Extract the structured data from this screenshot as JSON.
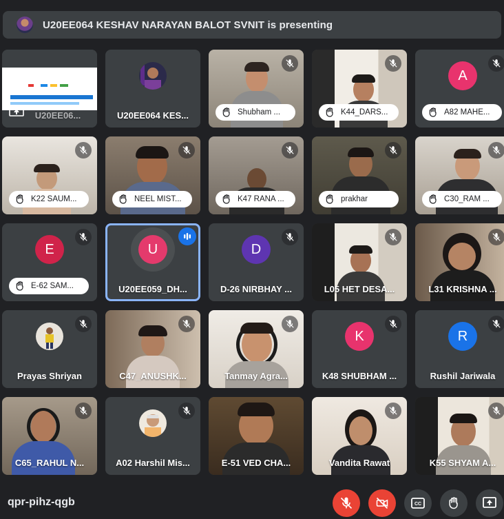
{
  "banner": {
    "text": "U20EE064 KESHAV NARAYAN BALOT SVNIT is presenting"
  },
  "tiles": [
    {
      "label": "U20EE06...",
      "kind": "screen"
    },
    {
      "label": "U20EE064 KES...",
      "kind": "avatar-photo"
    },
    {
      "label": "Shubham ...",
      "kind": "video"
    },
    {
      "label": "K44_DARS...",
      "kind": "video"
    },
    {
      "label": "A82 MAHE...",
      "kind": "letter",
      "letter": "A",
      "color": "#e8336d"
    },
    {
      "label": "K22 SAUM...",
      "kind": "video"
    },
    {
      "label": "NEEL MIST...",
      "kind": "video"
    },
    {
      "label": "K47 RANA ...",
      "kind": "video"
    },
    {
      "label": "prakhar",
      "kind": "video"
    },
    {
      "label": "C30_RAM ...",
      "kind": "video"
    },
    {
      "label": "E-62 SAM...",
      "kind": "letter",
      "letter": "E",
      "color": "#d0234a"
    },
    {
      "label": "U20EE059_DH...",
      "kind": "letter",
      "letter": "U",
      "color": "#e43a6c"
    },
    {
      "label": "D-26 NIRBHAY ...",
      "kind": "letter",
      "letter": "D",
      "color": "#5e35b1"
    },
    {
      "label": "L05 HET DESA...",
      "kind": "video"
    },
    {
      "label": "L31 KRISHNA ...",
      "kind": "video"
    },
    {
      "label": "Prayas Shriyan",
      "kind": "avatar-photo"
    },
    {
      "label": "C47_ANUSHK...",
      "kind": "video"
    },
    {
      "label": "Tanmay Agra...",
      "kind": "video"
    },
    {
      "label": "K48 SHUBHAM ...",
      "kind": "letter",
      "letter": "K",
      "color": "#e8336d"
    },
    {
      "label": "Rushil Jariwala",
      "kind": "letter",
      "letter": "R",
      "color": "#1a73e8"
    },
    {
      "label": "C65_RAHUL N...",
      "kind": "video"
    },
    {
      "label": "A02 Harshil Mis...",
      "kind": "avatar-photo"
    },
    {
      "label": "E-51 VED CHA...",
      "kind": "video"
    },
    {
      "label": "Vandita Rawat",
      "kind": "video"
    },
    {
      "label": "K55 SHYAM A...",
      "kind": "video"
    }
  ],
  "bottom": {
    "meeting_code": "qpr-pihz-qgb"
  },
  "colors": {
    "background": "#202124",
    "tile": "#3c4043",
    "danger": "#ea4335",
    "active_border": "#8ab4f8",
    "speaking": "#1a73e8"
  },
  "icons": [
    "mic-off-icon",
    "hand-raised-icon",
    "speaking-indicator-icon",
    "camera-off-icon",
    "captions-icon",
    "raise-hand-icon",
    "present-icon",
    "screen-share-icon"
  ]
}
